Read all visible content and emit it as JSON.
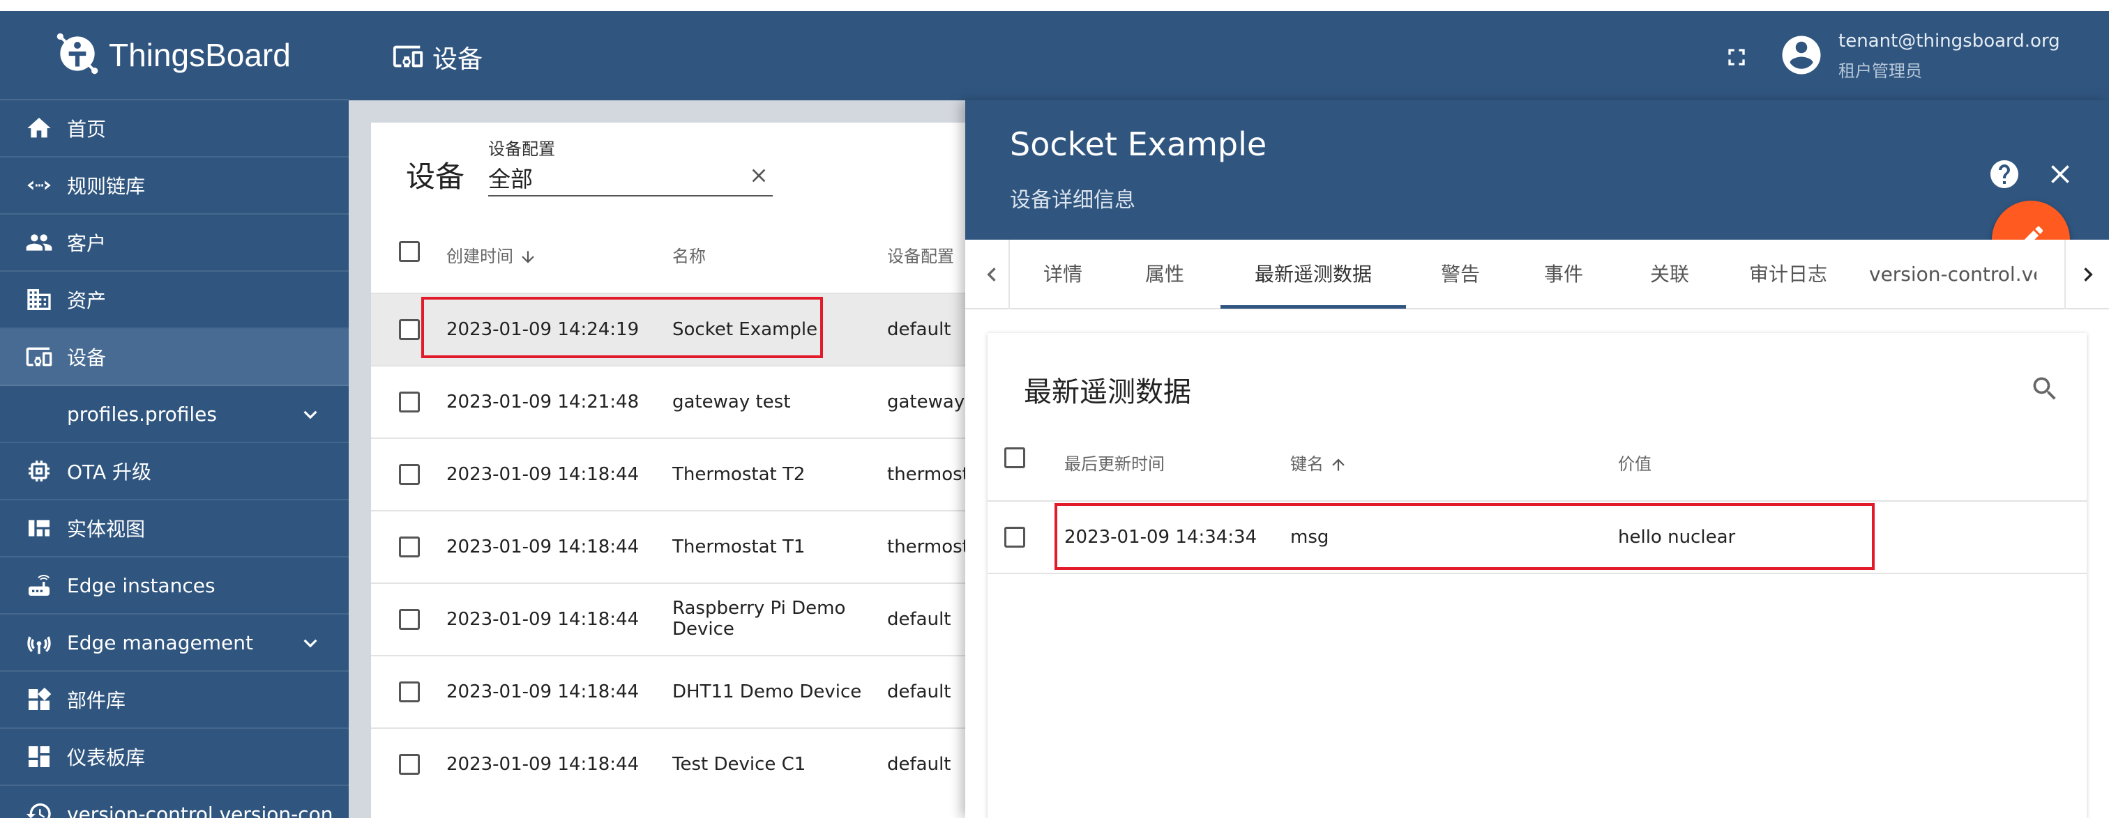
{
  "app": {
    "name": "ThingsBoard",
    "page_title": "设备"
  },
  "user": {
    "email": "tenant@thingsboard.org",
    "role": "租户管理员"
  },
  "sidebar": {
    "items": [
      {
        "label": "首页",
        "icon": "home-icon"
      },
      {
        "label": "规则链库",
        "icon": "code-arrows-icon"
      },
      {
        "label": "客户",
        "icon": "people-icon"
      },
      {
        "label": "资产",
        "icon": "building-icon"
      },
      {
        "label": "设备",
        "icon": "devices-icon",
        "active": true
      },
      {
        "label": "profiles.profiles",
        "icon": "",
        "expandable": true
      },
      {
        "label": "OTA 升级",
        "icon": "chip-icon"
      },
      {
        "label": "实体视图",
        "icon": "view-quilt-icon"
      },
      {
        "label": "Edge instances",
        "icon": "router-icon"
      },
      {
        "label": "Edge management",
        "icon": "antenna-icon",
        "expandable": true
      },
      {
        "label": "部件库",
        "icon": "widgets-icon"
      },
      {
        "label": "仪表板库",
        "icon": "dashboard-icon"
      },
      {
        "label": "version-control.version-con",
        "icon": "history-icon"
      }
    ]
  },
  "devices": {
    "title": "设备",
    "filter": {
      "label": "设备配置",
      "value": "全部"
    },
    "columns": {
      "created": "创建时间",
      "name": "名称",
      "profile": "设备配置"
    },
    "rows": [
      {
        "created": "2023-01-09 14:24:19",
        "name": "Socket Example",
        "profile": "default",
        "selected": true
      },
      {
        "created": "2023-01-09 14:21:48",
        "name": "gateway test",
        "profile": "gateway"
      },
      {
        "created": "2023-01-09 14:18:44",
        "name": "Thermostat T2",
        "profile": "thermostat"
      },
      {
        "created": "2023-01-09 14:18:44",
        "name": "Thermostat T1",
        "profile": "thermostat"
      },
      {
        "created": "2023-01-09 14:18:44",
        "name": "Raspberry Pi Demo Device",
        "profile": "default"
      },
      {
        "created": "2023-01-09 14:18:44",
        "name": "DHT11 Demo Device",
        "profile": "default"
      },
      {
        "created": "2023-01-09 14:18:44",
        "name": "Test Device C1",
        "profile": "default"
      }
    ]
  },
  "details": {
    "title": "Socket Example",
    "subtitle": "设备详细信息",
    "tabs": [
      "详情",
      "属性",
      "最新遥测数据",
      "警告",
      "事件",
      "关联",
      "审计日志",
      "version-control.ver"
    ],
    "active_tab": "最新遥测数据",
    "telemetry": {
      "title": "最新遥测数据",
      "columns": {
        "ts": "最后更新时间",
        "key": "键名",
        "value": "价值"
      },
      "rows": [
        {
          "ts": "2023-01-09 14:34:34",
          "key": "msg",
          "value": "hello nuclear"
        }
      ]
    }
  },
  "colors": {
    "primary": "#305680",
    "accent": "#ff5a1f",
    "highlight": "#e21b2a"
  }
}
